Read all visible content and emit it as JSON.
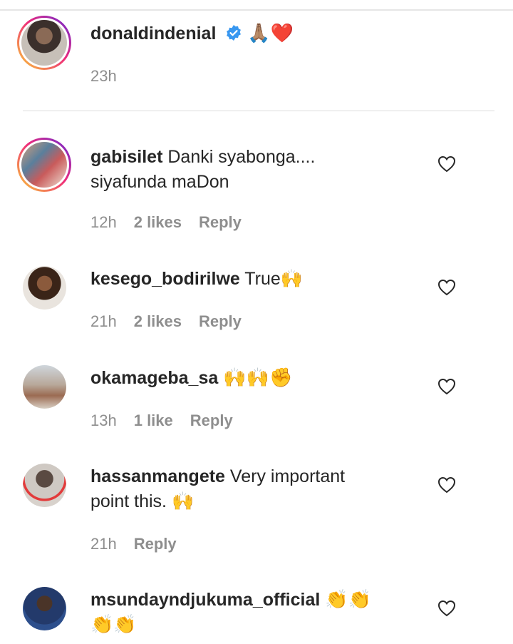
{
  "post": {
    "username": "donaldindenial",
    "verified": true,
    "caption_emoji": "🙏🏽❤️",
    "time": "23h"
  },
  "comments": [
    {
      "username": "gabisilet",
      "text_line1": "Danki syabonga....",
      "text_line2": "siyafunda maDon",
      "time": "12h",
      "likes": "2 likes",
      "reply": "Reply",
      "story_ring": true
    },
    {
      "username": "kesego_bodirilwe",
      "text_line1": "True🙌",
      "time": "21h",
      "likes": "2 likes",
      "reply": "Reply",
      "story_ring": false
    },
    {
      "username": "okamageba_sa",
      "text_line1": "🙌🙌✊",
      "time": "13h",
      "likes": "1 like",
      "reply": "Reply",
      "story_ring": false
    },
    {
      "username": "hassanmangete",
      "text_line1": "Very important",
      "text_line2": "point this. 🙌",
      "time": "21h",
      "likes": "",
      "reply": "Reply",
      "story_ring": false
    },
    {
      "username": "msundayndjukuma_official",
      "text_line1": "👏👏",
      "text_line2": "👏👏",
      "story_ring": false
    }
  ],
  "colors": {
    "text": "#262626",
    "meta": "#8e8e8e",
    "verified": "#3897f0",
    "divider": "#dbdbdb"
  }
}
